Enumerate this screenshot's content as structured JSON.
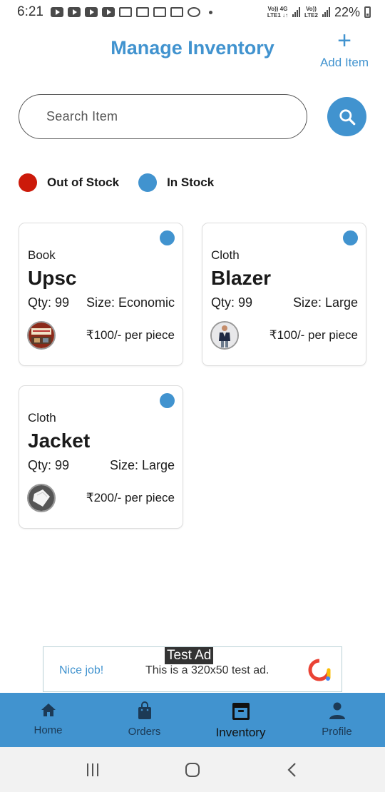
{
  "status_bar": {
    "time": "6:21",
    "network_1": "Vo)) 4G\nLTE1 ↓↑",
    "network_2": "Vo))\nLTE2",
    "battery": "22%"
  },
  "header": {
    "title": "Manage Inventory",
    "add_label": "Add Item",
    "add_icon": "plus-icon"
  },
  "search": {
    "placeholder": "Search Item",
    "value": "",
    "icon": "search-icon"
  },
  "legend": [
    {
      "label": "Out of Stock",
      "color": "#cc1a0a"
    },
    {
      "label": "In Stock",
      "color": "#4193cf"
    }
  ],
  "items": [
    {
      "category": "Book",
      "name": "Upsc",
      "qty": "Qty: 99",
      "size": "Size: Economic",
      "price": "₹100/- per piece",
      "status_color": "#4193cf",
      "thumb": "book-cover-thumbnail"
    },
    {
      "category": "Cloth",
      "name": "Blazer",
      "qty": "Qty: 99",
      "size": "Size: Large",
      "price": "₹100/- per piece",
      "status_color": "#4193cf",
      "thumb": "blazer-thumbnail"
    },
    {
      "category": "Cloth",
      "name": "Jacket",
      "qty": "Qty: 99",
      "size": "Size: Large",
      "price": "₹200/- per piece",
      "status_color": "#4193cf",
      "thumb": "jacket-thumbnail"
    }
  ],
  "ad": {
    "label": "Test Ad",
    "nice": "Nice job!",
    "text": "This is a 320x50 test ad."
  },
  "bottom_nav": [
    {
      "label": "Home",
      "icon": "home-icon"
    },
    {
      "label": "Orders",
      "icon": "shopping-bag-icon"
    },
    {
      "label": "Inventory",
      "icon": "archive-icon",
      "active": true
    },
    {
      "label": "Profile",
      "icon": "person-icon"
    }
  ],
  "colors": {
    "accent": "#4193cf",
    "out_of_stock": "#cc1a0a"
  }
}
